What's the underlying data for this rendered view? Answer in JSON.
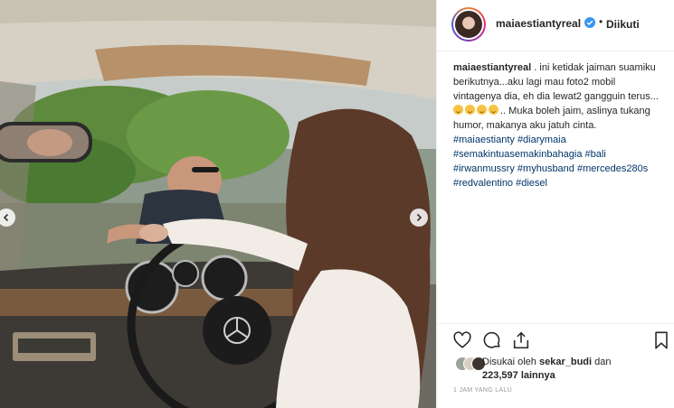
{
  "header": {
    "username": "maiaestiantyreal",
    "separator": "•",
    "follow_status": "Diikuti"
  },
  "caption": {
    "username": "maiaestiantyreal",
    "text_1": " . ini ketidak jaiman suamiku berikutnya...aku lagi mau foto2 mobil vintagenya dia, eh dia lewat2 gangguin terus...",
    "text_2": ".. Muka boleh jaim, aslinya tukang humor, makanya aku jatuh cinta.",
    "hashtags": [
      "#maiaestianty",
      "#diarymaia",
      "#semakintuasemakinbahagia",
      "#bali",
      "#irwanmussry",
      "#myhusband",
      "#mercedes280s",
      "#redvalentino",
      "#diesel"
    ]
  },
  "likes": {
    "prefix": "Disukai oleh ",
    "first_user": "sekar_budi",
    "connector": " dan",
    "count": "223,597",
    "suffix": " lainnya"
  },
  "time": "1 JAM YANG LALU",
  "icons": {
    "verified": "verified-badge-icon",
    "like": "heart-icon",
    "comment": "comment-icon",
    "share": "share-icon",
    "save": "bookmark-icon",
    "prev": "chevron-left-icon",
    "next": "chevron-right-icon"
  },
  "colors": {
    "verified_blue": "#3897f0",
    "hashtag": "#003569",
    "text": "#262626",
    "muted": "#999999"
  }
}
